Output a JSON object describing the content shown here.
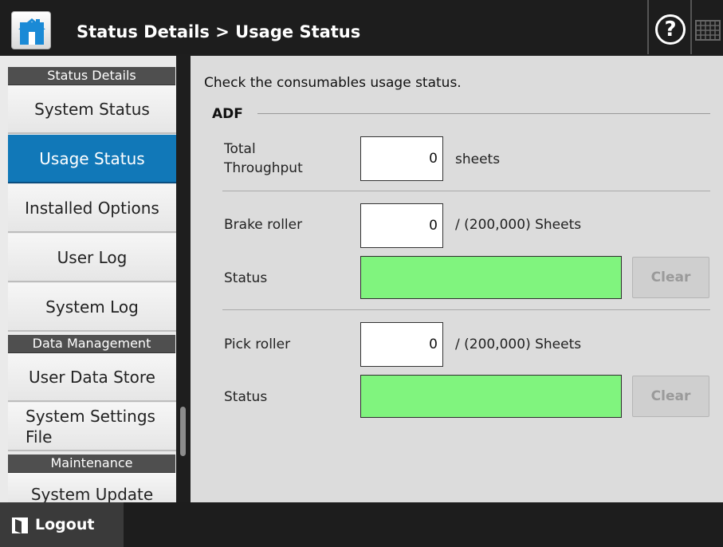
{
  "header": {
    "title": "Status Details > Usage Status",
    "home_icon": "home-icon",
    "help_icon": "?",
    "keyboard_icon": "keyboard-icon"
  },
  "sidebar": {
    "sections": [
      {
        "heading": "Status Details",
        "items": [
          "System Status",
          "Usage Status",
          "Installed Options",
          "User Log",
          "System Log"
        ]
      },
      {
        "heading": "Data Management",
        "items": [
          "User Data Store",
          "System Settings File"
        ]
      },
      {
        "heading": "Maintenance",
        "items": [
          "System Update"
        ]
      }
    ],
    "active_item": "Usage Status",
    "active_color": "#1178b8"
  },
  "main": {
    "intro": "Check the consumables usage status.",
    "section_title": "ADF",
    "total_throughput": {
      "label": "Total Throughput",
      "value": "0",
      "unit": "sheets"
    },
    "brake_roller": {
      "label": "Brake roller",
      "value": "0",
      "unit": "/ (200,000) Sheets",
      "status_label": "Status",
      "status_color": "#80f47e",
      "clear_label": "Clear"
    },
    "pick_roller": {
      "label": "Pick roller",
      "value": "0",
      "unit": "/ (200,000) Sheets",
      "status_label": "Status",
      "status_color": "#80f47e",
      "clear_label": "Clear"
    }
  },
  "footer": {
    "logout_label": "Logout"
  }
}
